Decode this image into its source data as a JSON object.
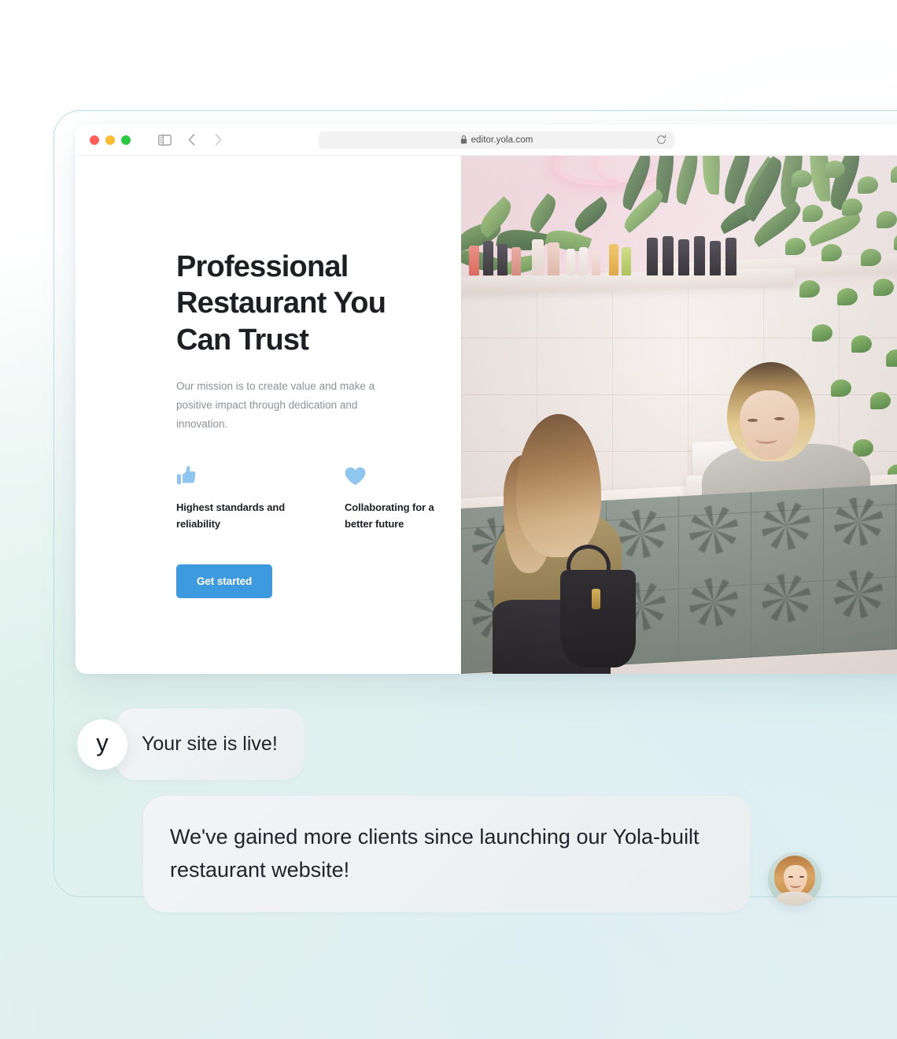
{
  "browser": {
    "traffic_lights": [
      "close",
      "minimize",
      "maximize"
    ],
    "sidebar_toggle_icon": "sidebar-icon",
    "back_icon": "chevron-left-icon",
    "forward_icon": "chevron-right-icon",
    "shield_icon": "shield-icon",
    "lock_icon": "lock-icon",
    "url": "editor.yola.com",
    "reload_icon": "reload-icon"
  },
  "hero": {
    "headline": "Professional Restaurant You Can Trust",
    "subcopy": "Our mission is to create value and make a positive impact through dedication and innovation.",
    "features": [
      {
        "icon": "thumbs-up-icon",
        "label": "Highest standards and reliability"
      },
      {
        "icon": "heart-icon",
        "label": "Collaborating for a better future"
      }
    ],
    "cta_label": "Get started",
    "image_alt": "Two women at a shop counter with plants"
  },
  "chat": {
    "brand_avatar_letter": "y",
    "messages": [
      {
        "from": "yola",
        "text": "Your site is live!"
      },
      {
        "from": "customer",
        "text": "We've gained more clients since launching our Yola-built restaurant website!"
      }
    ],
    "customer_avatar_alt": "Smiling woman portrait"
  },
  "colors": {
    "cta_blue": "#3d9ade",
    "feature_icon_blue": "#8ec6ef",
    "headline": "#1d1f23",
    "body_text": "#8d9197",
    "bubble_bg": "#eef1f2",
    "frame_border": "#bcdde8"
  }
}
